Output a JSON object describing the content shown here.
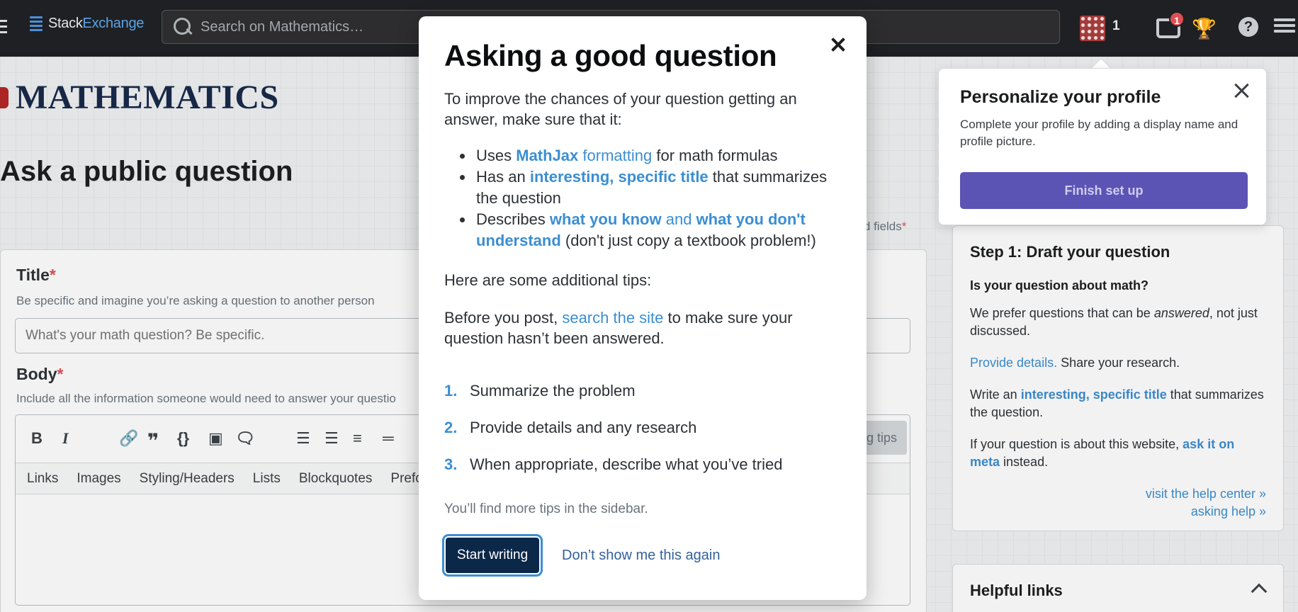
{
  "topbar": {
    "logo_prefix": "Stack",
    "logo_suffix": "Exchange",
    "search_placeholder": "Search on Mathematics…",
    "reputation": "1",
    "inbox_count": "1",
    "help_glyph": "?"
  },
  "site": {
    "name": "MATHEMATICS",
    "page_title": "Ask a public question",
    "required_fields_label": "ired fields",
    "required_marker": "*"
  },
  "form": {
    "title_label": "Title",
    "title_hint": "Be specific and imagine you’re asking a question to another person",
    "title_placeholder": "What's your math question? Be specific.",
    "body_label": "Body",
    "body_hint": "Include all the information someone would need to answer your questio",
    "toolbar": {
      "bold": "B",
      "italic": "I",
      "code": "{}",
      "tips_label": "g tips"
    },
    "help_tabs": [
      "Links",
      "Images",
      "Styling/Headers",
      "Lists",
      "Blockquotes",
      "Prefor"
    ]
  },
  "sidebar": {
    "heading": "Step 1: Draft your question",
    "question": "Is your question about math?",
    "p1_before": "We prefer questions that can be ",
    "p1_em": "answered",
    "p1_after": ", not just discussed.",
    "p2_link": "Provide details.",
    "p2_after": " Share your research.",
    "p3_before": "Write an ",
    "p3_bold": "interesting, specific title",
    "p3_after": " that summarizes the question.",
    "p4_before": "If your question is about this website, ",
    "p4_bold": "ask it on meta",
    "p4_after": " instead.",
    "link1": "visit the help center »",
    "link2": "asking help »",
    "helpful_links": "Helpful links"
  },
  "popover": {
    "title": "Personalize your profile",
    "text": "Complete your profile by adding a display name and profile picture.",
    "button": "Finish set up"
  },
  "modal": {
    "title": "Asking a good question",
    "intro": "To improve the chances of your question getting an answer, make sure that it:",
    "bullet1_a": "Uses ",
    "bullet1_b": "MathJax",
    "bullet1_c": " formatting",
    "bullet1_d": " for math formulas",
    "bullet2_a": "Has an ",
    "bullet2_b": "interesting, specific title",
    "bullet2_c": " that summarizes the question",
    "bullet3_a": "Describes ",
    "bullet3_b": "what you know",
    "bullet3_c": " and ",
    "bullet3_d": "what you don't understand",
    "bullet3_e": " (don't just copy a textbook problem!)",
    "tips_intro": "Here are some additional tips:",
    "search_a": "Before you post, ",
    "search_link": "search the site",
    "search_b": " to make sure your question hasn’t been answered.",
    "steps": [
      {
        "num": "1.",
        "text": "Summarize the problem"
      },
      {
        "num": "2.",
        "text": "Provide details and any research"
      },
      {
        "num": "3.",
        "text": "When appropriate, describe what you’ve tried"
      }
    ],
    "sidebar_note": "You’ll find more tips in the sidebar.",
    "start_button": "Start writing",
    "dont_show": "Don’t show me this again"
  },
  "colors": {
    "topbar_bg": "#1f2023",
    "link_blue": "#3b8ed2",
    "primary_dark": "#0c2849",
    "finish_button": "#5b54b5",
    "required_red": "#de4f54"
  }
}
